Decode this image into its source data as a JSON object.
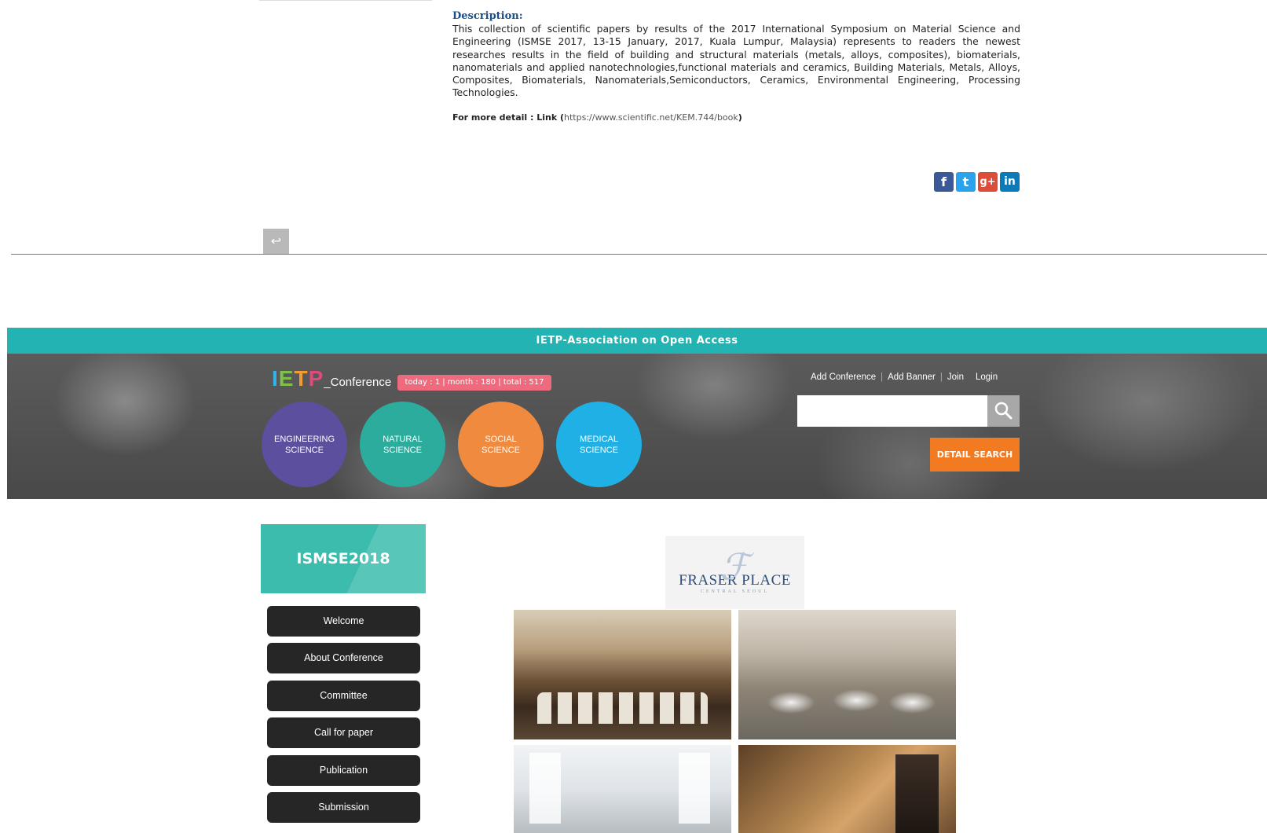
{
  "description": {
    "title": "Description:",
    "text": "This collection of scientific papers by results of the 2017 International Symposium on Material Science and Engineering (ISMSE 2017, 13-15 January, 2017, Kuala Lumpur, Malaysia) represents to readers the newest researches results in the field of building and structural materials (metals, alloys, composites), biomaterials, nanomaterials and applied nanotechnologies,functional materials and ceramics, Building Materials, Metals, Alloys, Composites, Biomaterials, Nanomaterials,Semiconductors, Ceramics, Environmental Engineering, Processing Technologies.",
    "more_label": "For more detail : Link (",
    "more_link": "https://www.scientific.net/KEM.744/book",
    "more_close": ")"
  },
  "share": {
    "facebook": "f",
    "twitter": "t",
    "googleplus": "g+",
    "linkedin": "in"
  },
  "back_icon": "↩",
  "header": {
    "association": "IETP-Association on Open Access",
    "logo_letters": [
      "I",
      "E",
      "T",
      "P"
    ],
    "logo_suffix": "_Conference",
    "stats": "today : 1   |   month : 180   |   total : 517",
    "categories": [
      "ENGINEERING\nSCIENCE",
      "NATURAL\nSCIENCE",
      "SOCIAL\nSCIENCE",
      "MEDICAL\nSCIENCE"
    ],
    "links": [
      "Add Conference",
      "Add Banner",
      "Join",
      "Login"
    ],
    "search_placeholder": "",
    "detail_search": "DETAIL SEARCH"
  },
  "sidebar": {
    "title": "ISMSE2018",
    "items": [
      "Welcome",
      "About Conference",
      "Committee",
      "Call for paper",
      "Publication",
      "Submission"
    ]
  },
  "venue": {
    "logo_name": "FRASER PLACE",
    "logo_sub": "CENTRAL SEOUL"
  }
}
